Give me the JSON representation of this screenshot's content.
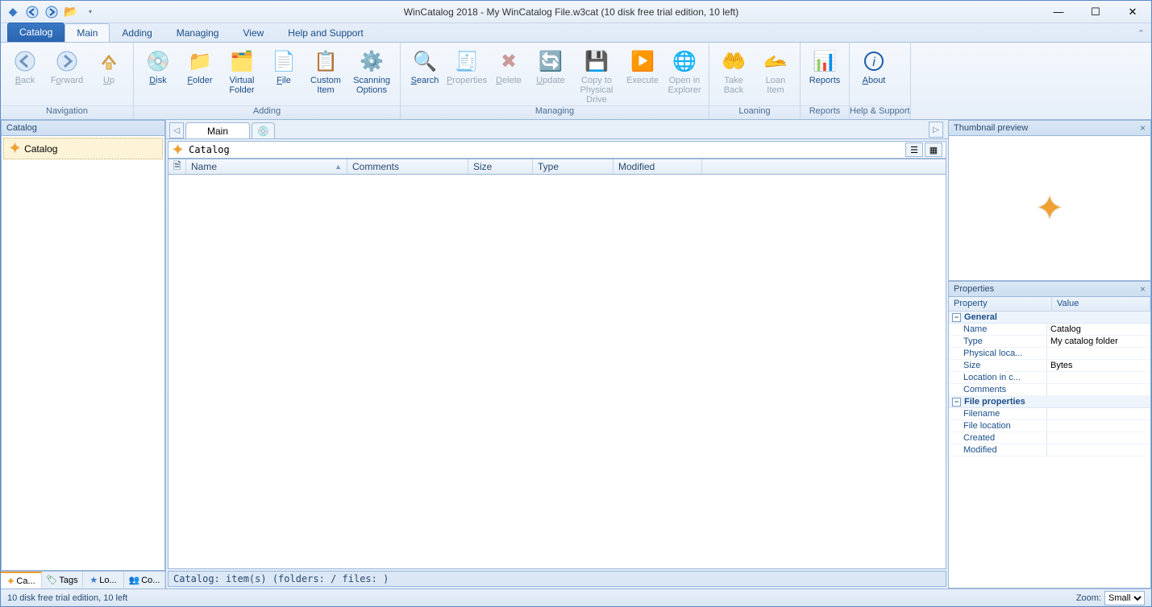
{
  "title": "WinCatalog 2018 - My WinCatalog File.w3cat (10 disk free trial edition, 10 left)",
  "menutabs": {
    "file": "Catalog",
    "main": "Main",
    "adding": "Adding",
    "managing": "Managing",
    "view": "View",
    "help": "Help and Support"
  },
  "ribbon": {
    "navigation": {
      "label": "Navigation",
      "back": "Back",
      "forward": "Forward",
      "up": "Up"
    },
    "adding": {
      "label": "Adding",
      "disk": "Disk",
      "folder": "Folder",
      "vfolder_l1": "Virtual",
      "vfolder_l2": "Folder",
      "file": "File",
      "citem_l1": "Custom",
      "citem_l2": "Item",
      "scan_l1": "Scanning",
      "scan_l2": "Options"
    },
    "managing": {
      "label": "Managing",
      "search": "Search",
      "properties": "Properties",
      "delete": "Delete",
      "update": "Update",
      "copy_l1": "Copy to",
      "copy_l2": "Physical Drive",
      "execute": "Execute",
      "open_l1": "Open in",
      "open_l2": "Explorer"
    },
    "loaning": {
      "label": "Loaning",
      "take_l1": "Take",
      "take_l2": "Back",
      "loan_l1": "Loan",
      "loan_l2": "Item"
    },
    "reports": {
      "label": "Reports",
      "reports": "Reports"
    },
    "helpg": {
      "label": "Help & Support",
      "about": "About"
    }
  },
  "left": {
    "header": "Catalog",
    "root": "Catalog",
    "tabs": {
      "catalog": "Ca...",
      "tags": "Tags",
      "locations": "Lo...",
      "contacts": "Co..."
    }
  },
  "center": {
    "tab_main": "Main",
    "path": "Catalog",
    "columns": {
      "icon": "",
      "name": "Name",
      "comments": "Comments",
      "size": "Size",
      "type": "Type",
      "modified": "Modified"
    },
    "statusline": "Catalog:  item(s) (folders:  / files: )"
  },
  "right": {
    "thumb_header": "Thumbnail preview",
    "props_header": "Properties",
    "col_property": "Property",
    "col_value": "Value",
    "cat_general": "General",
    "rows_general": [
      {
        "k": "Name",
        "v": "Catalog"
      },
      {
        "k": "Type",
        "v": "My catalog folder"
      },
      {
        "k": "Physical loca...",
        "v": ""
      },
      {
        "k": "Size",
        "v": " Bytes"
      },
      {
        "k": "Location in c...",
        "v": ""
      },
      {
        "k": "Comments",
        "v": ""
      }
    ],
    "cat_fileprops": "File properties",
    "rows_file": [
      {
        "k": "Filename",
        "v": ""
      },
      {
        "k": "File location",
        "v": ""
      },
      {
        "k": "Created",
        "v": ""
      },
      {
        "k": "Modified",
        "v": ""
      }
    ]
  },
  "status": {
    "left": "10 disk free trial edition, 10 left",
    "zoom_label": "Zoom:",
    "zoom_value": "Small"
  }
}
